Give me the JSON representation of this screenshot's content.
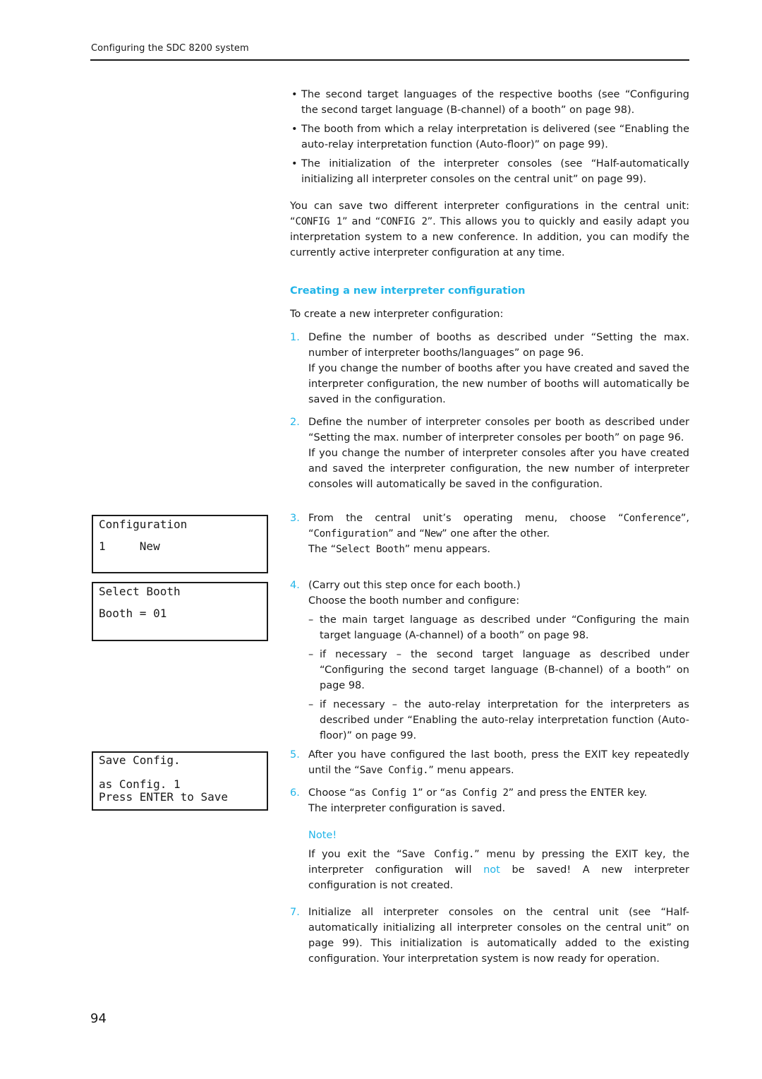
{
  "header": {
    "running_title": "Configuring the SDC 8200 system"
  },
  "bullets": [
    "The second target languages of the respective booths (see “Configuring the second target language (B-channel) of a booth” on page 98).",
    "The booth from which a relay interpretation is delivered (see “Enabling the auto-relay interpretation function (Auto-floor)” on page 99).",
    "The initialization of the interpreter consoles (see “Half-automatically initializing all interpreter consoles on the central unit” on page 99)."
  ],
  "intro": {
    "part1": "You can save two different interpreter configurations in the central unit: “",
    "config1": "CONFIG 1",
    "part2": "” and “",
    "config2": "CONFIG 2",
    "part3": "”. This allows you to quickly and easily adapt you interpretation system to a new conference. In addition, you can modify the currently active interpreter configuration at any time."
  },
  "section": {
    "heading": "Creating a new interpreter configuration",
    "lead": "To create a new interpreter configuration:"
  },
  "steps": {
    "s1": {
      "num": "1.",
      "text": "Define the number of booths as described under “Setting the max. number of interpreter booths/languages” on page 96.",
      "extra": "If you change the number of booths after you have created and saved the interpreter configuration, the new number of booths will automatically be saved in the configuration."
    },
    "s2": {
      "num": "2.",
      "text": "Define the number of interpreter consoles per booth as described under “Setting the max. number of interpreter consoles per booth” on page 96.",
      "extra": "If you change the number of interpreter consoles after you have created and saved the interpreter configuration, the new number of interpreter consoles will automatically be saved in the configuration."
    },
    "s3": {
      "num": "3.",
      "a": "From the central unit’s operating menu, choose “",
      "m1": "Conference",
      "b": "”, “",
      "m2": "Configuration",
      "c": "” and “",
      "m3": "New",
      "d": "” one after the other.",
      "e": "The “",
      "m4": "Select Booth",
      "f": "” menu appears."
    },
    "s4": {
      "num": "4.",
      "text": "(Carry out this step once for each booth.)",
      "text2": "Choose the booth number and configure:",
      "dashes": [
        "the main target language as described under “Configuring the main target language (A-channel) of a booth” on page 98.",
        "if necessary – the second target language as described under “Configuring the second target language (B-channel) of a booth” on page 98.",
        "if necessary – the auto-relay interpretation for the interpreters as described under “Enabling the auto-relay interpretation function (Auto-floor)” on page 99."
      ]
    },
    "s5": {
      "num": "5.",
      "a": "After you have configured the last booth, press the EXIT key repeatedly until the “",
      "m1": "Save Config.",
      "b": "” menu appears."
    },
    "s6": {
      "num": "6.",
      "a": "Choose “",
      "m1": "as Config 1",
      "b": "” or “",
      "m2": "as Config 2",
      "c": "” and press the ENTER key.",
      "d": "The interpreter configuration is saved."
    },
    "note": {
      "title": "Note!",
      "a": "If you exit the “",
      "m1": "Save Config.",
      "b": "” menu by pressing the EXIT key, the interpreter configuration will ",
      "hl": "not",
      "c": " be saved! A new interpreter configuration is not created."
    },
    "s7": {
      "num": "7.",
      "text": "Initialize all interpreter consoles on the central unit (see “Half-automatically initializing all interpreter consoles on the central unit” on page 99). This initialization is automatically added to the existing configuration. Your interpretation system is now ready for operation."
    }
  },
  "displays": {
    "configuration": {
      "line1": "Configuration",
      "line2": "1     New"
    },
    "select_booth": {
      "line1": "Select Booth",
      "line2": "Booth = 01"
    },
    "save_config": {
      "line1": "Save Config.",
      "line2": "as Config. 1",
      "line3": "Press ENTER to Save"
    }
  },
  "footer": {
    "page_number": "94"
  },
  "colors": {
    "accent": "#21b4e8",
    "text": "#1a1a1a"
  }
}
